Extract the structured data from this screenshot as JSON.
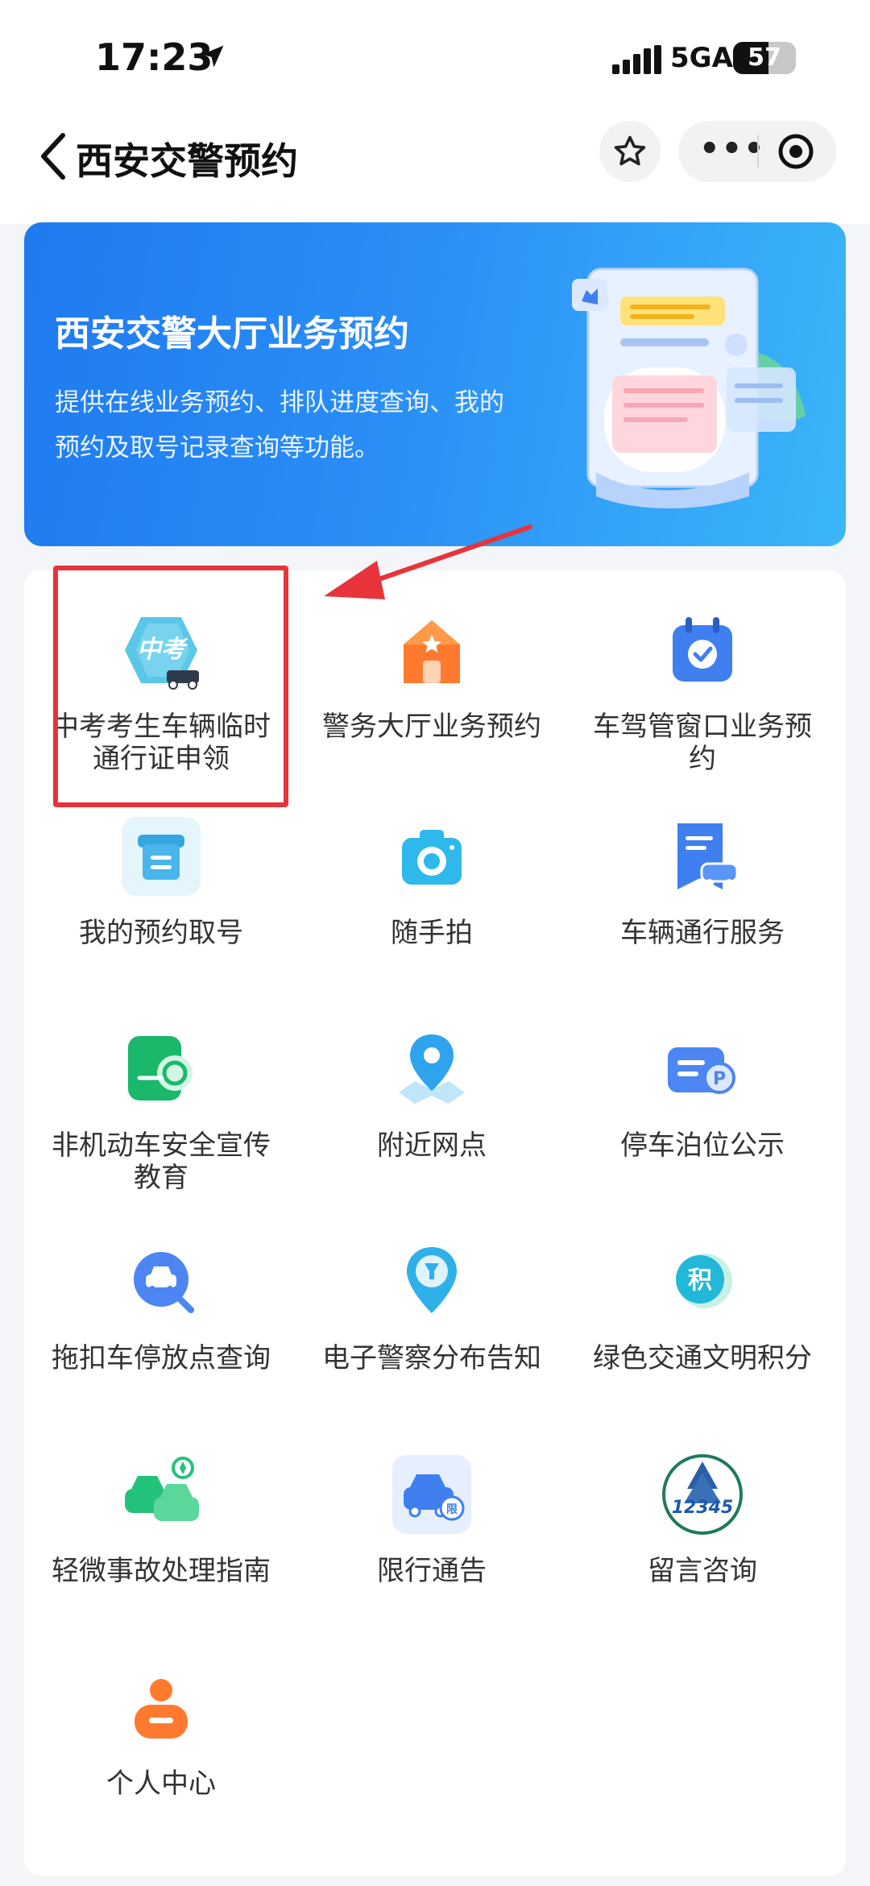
{
  "status_bar": {
    "time": "17:23",
    "network": "5GA",
    "battery": "57",
    "battery_level": 0.57
  },
  "nav": {
    "title": "西安交警预约"
  },
  "banner": {
    "title": "西安交警大厅业务预约",
    "description": "提供在线业务预约、排队进度查询、我的预约及取号记录查询等功能。"
  },
  "services": [
    {
      "label": "中考考生车辆临时通行证申领",
      "icon": "zhongkao-car-icon"
    },
    {
      "label": "警务大厅业务预约",
      "icon": "police-hall-icon"
    },
    {
      "label": "车驾管窗口业务预约",
      "icon": "calendar-check-icon"
    },
    {
      "label": "我的预约取号",
      "icon": "ticket-icon"
    },
    {
      "label": "随手拍",
      "icon": "camera-icon"
    },
    {
      "label": "车辆通行服务",
      "icon": "vehicle-pass-icon"
    },
    {
      "label": "非机动车安全宣传教育",
      "icon": "bike-safety-icon"
    },
    {
      "label": "附近网点",
      "icon": "map-pin-icon"
    },
    {
      "label": "停车泊位公示",
      "icon": "parking-icon"
    },
    {
      "label": "拖扣车停放点查询",
      "icon": "tow-search-icon"
    },
    {
      "label": "电子警察分布告知",
      "icon": "e-police-icon"
    },
    {
      "label": "绿色交通文明积分",
      "icon": "green-points-icon"
    },
    {
      "label": "轻微事故处理指南",
      "icon": "accident-icon"
    },
    {
      "label": "限行通告",
      "icon": "restriction-icon"
    },
    {
      "label": "留言咨询",
      "icon": "hotline-12345-icon"
    },
    {
      "label": "个人中心",
      "icon": "user-icon"
    }
  ],
  "icon_extras": {
    "zhongkao_text": "中考",
    "points_char": "积",
    "restrict_char": "限",
    "hotline_text": "12345",
    "parking_char": "P"
  },
  "colors": {
    "highlight": "#e8333a",
    "banner_start": "#1f7af0",
    "banner_end": "#3bb6f8"
  }
}
